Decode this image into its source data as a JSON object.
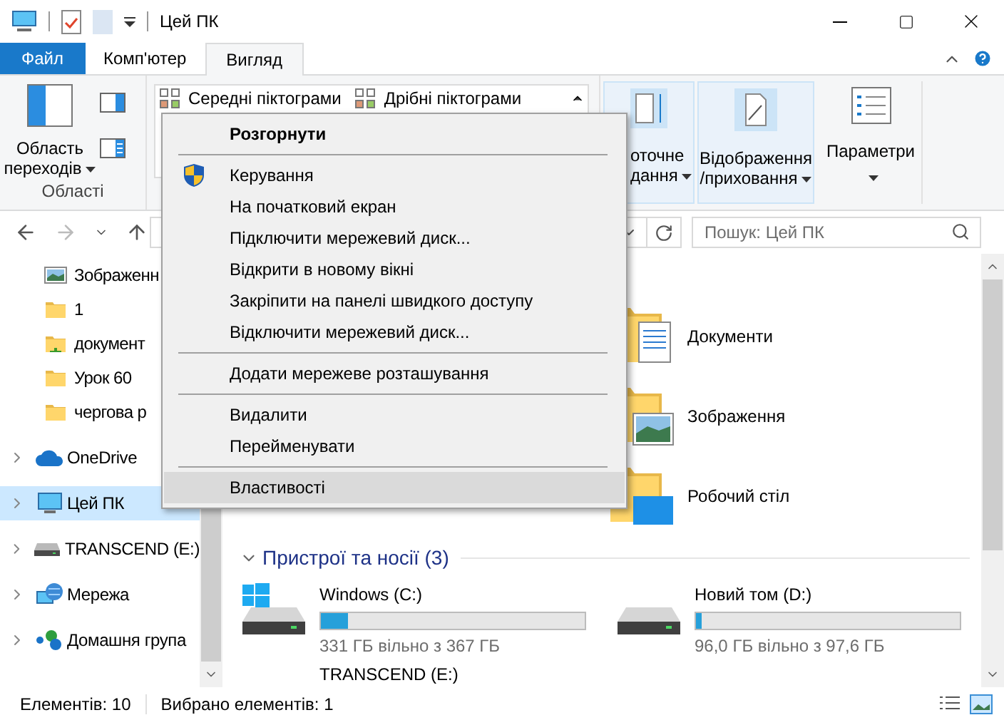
{
  "window": {
    "title": "Цей ПК"
  },
  "ribbon_tabs": [
    {
      "label": "Файл",
      "kind": "file",
      "selected": false
    },
    {
      "label": "Комп'ютер",
      "kind": "tab",
      "selected": false
    },
    {
      "label": "Вигляд",
      "kind": "tab",
      "selected": true
    }
  ],
  "ribbon": {
    "navigation_pane": {
      "label_lines": [
        "Область",
        "переходів"
      ]
    },
    "panes_group_label": "Області",
    "layout_gallery": [
      "Середні піктограми",
      "Дрібні піктограми"
    ],
    "current_view": {
      "label_lines": [
        "оточне",
        "дання"
      ]
    },
    "show_hide": {
      "label_lines": [
        "Відображення",
        "/приховання"
      ]
    },
    "options": {
      "label": "Параметри"
    }
  },
  "search": {
    "placeholder": "Пошук: Цей ПК"
  },
  "nav_pane": {
    "quick_access": [
      {
        "label": "Зображенн",
        "kind": "pictures"
      },
      {
        "label": "1",
        "kind": "folder"
      },
      {
        "label": "документ",
        "kind": "shared"
      },
      {
        "label": "Урок 60",
        "kind": "folder"
      },
      {
        "label": "чергова р",
        "kind": "folder"
      }
    ],
    "items": [
      {
        "label": "OneDrive",
        "kind": "cloud",
        "selected": false
      },
      {
        "label": "Цей ПК",
        "kind": "pc",
        "selected": true
      },
      {
        "label": "TRANSCEND (E:)",
        "kind": "drive",
        "selected": false
      },
      {
        "label": "Мережа",
        "kind": "network",
        "selected": false
      },
      {
        "label": "Домашня група",
        "kind": "homegroup",
        "selected": false
      }
    ]
  },
  "content": {
    "folders": [
      {
        "name": "Документи",
        "kind": "documents"
      },
      {
        "name": "Зображення",
        "kind": "pictures"
      },
      {
        "name": "Робочий стіл",
        "kind": "desktop"
      }
    ],
    "devices_header": "Пристрої та носії (3)",
    "drives": [
      {
        "name": "Windows (C:)",
        "kind": "system",
        "level": 0.1,
        "free": "331 ГБ вільно з 367 ГБ"
      },
      {
        "name": "Новий том (D:)",
        "kind": "disk",
        "level": 0.02,
        "free": "96,0 ГБ вільно з 97,6 ГБ"
      },
      {
        "name": "TRANSCEND (E:)",
        "kind": "usb"
      }
    ]
  },
  "context_menu": [
    {
      "label": "Розгорнути",
      "kind": "default",
      "selected": false
    },
    {
      "kind": "separator"
    },
    {
      "label": "Керування",
      "kind": "admin",
      "selected": false
    },
    {
      "label": "На початковий екран",
      "kind": "item",
      "selected": false
    },
    {
      "label": "Підключити мережевий диск...",
      "kind": "item",
      "selected": false
    },
    {
      "label": "Відкрити в новому вікні",
      "kind": "item",
      "selected": false
    },
    {
      "label": "Закріпити на панелі швидкого доступу",
      "kind": "item",
      "selected": false
    },
    {
      "label": "Відключити мережевий диск...",
      "kind": "item",
      "selected": false
    },
    {
      "kind": "separator"
    },
    {
      "label": "Додати мережеве розташування",
      "kind": "item",
      "selected": false
    },
    {
      "kind": "separator"
    },
    {
      "label": "Видалити",
      "kind": "item",
      "selected": false
    },
    {
      "label": "Перейменувати",
      "kind": "item",
      "selected": false
    },
    {
      "kind": "separator"
    },
    {
      "label": "Властивості",
      "kind": "item",
      "selected": true
    }
  ],
  "status_bar": {
    "items_count": "Елементів: 10",
    "selected_count": "Вибрано елементів: 1"
  }
}
